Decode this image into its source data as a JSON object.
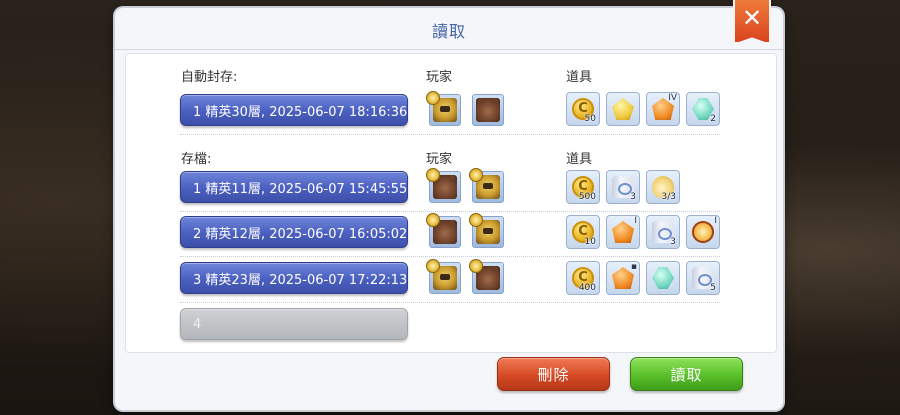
{
  "dialog": {
    "title": "讀取",
    "close_icon": "close-x-icon"
  },
  "auto_save": {
    "label": "自動封存:",
    "players_label": "玩家",
    "items_label": "道具",
    "slot": {
      "text": "1  精英30層, 2025-06-07 18:16:36",
      "players": [
        "knight-avatar-icon",
        "bear-avatar-icon"
      ],
      "items": [
        {
          "icon": "gold-coin-icon",
          "qty": "50"
        },
        {
          "icon": "gold-gem-icon",
          "qty": ""
        },
        {
          "icon": "orange-gem-icon",
          "qty": "",
          "tag": "IV"
        },
        {
          "icon": "teal-gem-icon",
          "qty": "2"
        }
      ]
    }
  },
  "saves": {
    "label": "存檔:",
    "players_label": "玩家",
    "items_label": "道具",
    "slots": [
      {
        "text": "1  精英11層, 2025-06-07 15:45:55",
        "players": [
          "bear-avatar-icon",
          "knight-avatar-icon"
        ],
        "items": [
          {
            "icon": "gold-coin-icon",
            "qty": "500"
          },
          {
            "icon": "scroll-icon",
            "qty": "3"
          },
          {
            "icon": "pouch-icon",
            "qty": "3/3"
          }
        ]
      },
      {
        "text": "2  精英12層, 2025-06-07 16:05:02",
        "players": [
          "bear-avatar-icon",
          "knight-avatar-icon"
        ],
        "items": [
          {
            "icon": "gold-coin-icon",
            "qty": "10"
          },
          {
            "icon": "orange-gem-icon",
            "qty": "",
            "tag": "I"
          },
          {
            "icon": "scroll-icon",
            "qty": "3"
          },
          {
            "icon": "compass-icon",
            "qty": "",
            "tag": "I"
          }
        ]
      },
      {
        "text": "3  精英23層, 2025-06-07 17:22:13",
        "players": [
          "knight-avatar-icon",
          "bear-avatar-icon"
        ],
        "items": [
          {
            "icon": "gold-coin-icon",
            "qty": "400"
          },
          {
            "icon": "orange-gem-icon",
            "qty": "",
            "tag": "▪"
          },
          {
            "icon": "teal-gem-icon",
            "qty": ""
          },
          {
            "icon": "scroll-icon",
            "qty": "5"
          }
        ]
      },
      {
        "text": "4",
        "empty": true
      }
    ]
  },
  "actions": {
    "delete_label": "刪除",
    "load_label": "讀取"
  },
  "colors": {
    "slot_blue": "#4a5fc0",
    "delete_red": "#d54a24",
    "load_green": "#59bf2a",
    "title_blue": "#4565a8"
  }
}
